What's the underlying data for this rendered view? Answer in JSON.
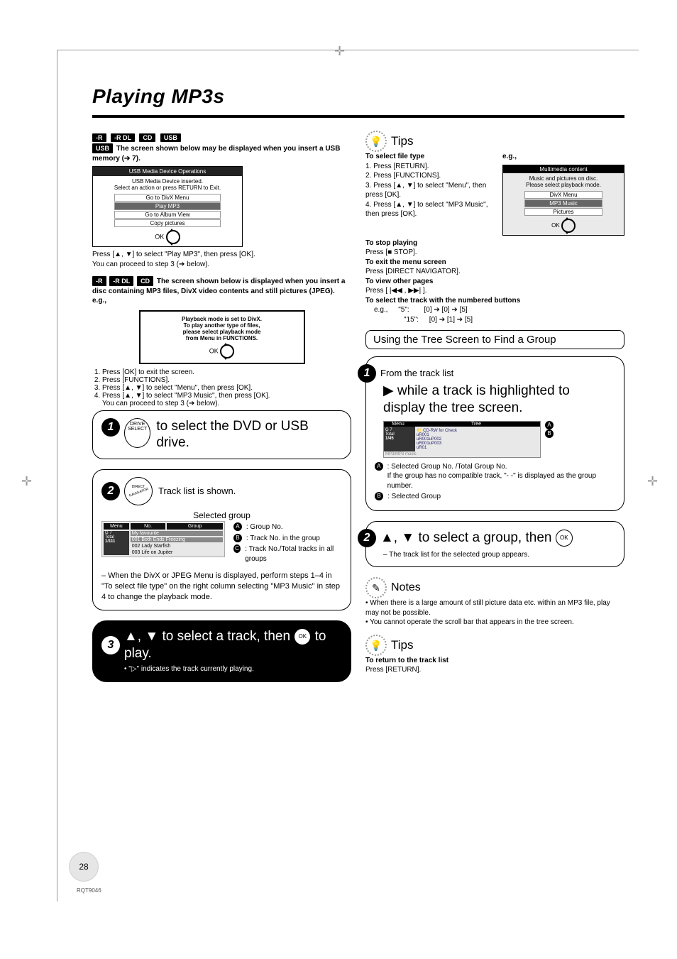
{
  "title": "Playing MP3s",
  "badges": {
    "r": "-R",
    "rdl": "-R DL",
    "cd": "CD",
    "usb": "USB"
  },
  "left": {
    "usb_note": "The screen shown below may be displayed when you insert a USB memory (➔ 7).",
    "usb_panel": {
      "header": "USB Media Device Operations",
      "sub": "USB Media Device inserted.\nSelect an action or press RETURN to Exit.",
      "rows": [
        "Go to DivX Menu",
        "Play MP3",
        "Go to Album View",
        "Copy pictures"
      ],
      "ok": "OK"
    },
    "after_panel": "Press [▲, ▼] to select \"Play MP3\", then press [OK].\nYou can proceed to step 3 (➔ below).",
    "disc_note": "The screen shown below is displayed when you insert a disc containing MP3 files, DivX video contents and still pictures (JPEG).",
    "eg": "e.g.,",
    "modal": {
      "line": "Playback mode is set to DivX.\nTo play another type of files,\nplease select playback mode\nfrom Menu in FUNCTIONS.",
      "ok": "OK"
    },
    "steps_pre": {
      "s1": "Press [OK] to exit the screen.",
      "s2": "Press [FUNCTIONS].",
      "s3": "Press [▲, ▼] to select \"Menu\", then press [OK].",
      "s4": "Press [▲, ▼] to select \"MP3 Music\", then press [OK].\nYou can proceed to step 3 (➔ below)."
    },
    "big1": {
      "btn": "DRIVE\nSELECT",
      "text": "to select the DVD or USB drive."
    },
    "big2": {
      "text": "Track list is shown.",
      "selgrp": "Selected group",
      "la": "Group No.",
      "lb": "Track No. in the group",
      "lc": "Track No./Total tracks in all groups",
      "note": "– When the DivX or JPEG Menu is displayed, perform steps 1–4 in \"To select file type\" on the right column selecting \"MP3 Music\" in step 4 to change the playback mode.",
      "table": {
        "menu": "Menu",
        "no": "No.",
        "group": "Group",
        "g": "G",
        "t": "Total",
        "gv": "7",
        "tv": "1",
        "totv": "1/111",
        "r1": "001 Both Ends Freezing",
        "r2": "002 Lady Starfish",
        "r3": "003 Life on Jupiter",
        "grp": "My favourite"
      }
    },
    "big3": {
      "text": "▲, ▼ to select a track, then",
      "to_play": "to play.",
      "foot": "• \"▷\" indicates the track currently playing.",
      "ok": "OK"
    }
  },
  "right": {
    "tips1": "Tips",
    "sel_type": {
      "h": "To select file type",
      "s1": "1. Press [RETURN].",
      "s2": "2. Press [FUNCTIONS].",
      "s3": "3. Press [▲, ▼] to select \"Menu\", then press [OK].",
      "s4": "4. Press [▲, ▼] to select \"MP3 Music\", then press [OK]."
    },
    "panel_lg": {
      "eg": "e.g.,",
      "title": "Multimedia content",
      "sub": "Music and pictures on disc.\nPlease select playback mode.",
      "rows": [
        "DivX Menu",
        "MP3 Music",
        "Pictures"
      ],
      "ok": "OK"
    },
    "stop": {
      "h": "To stop playing",
      "b": "Press [■ STOP]."
    },
    "exit": {
      "h": "To exit the menu screen",
      "b": "Press [DIRECT NAVIGATOR]."
    },
    "other": {
      "h": "To view other pages",
      "b": "Press [ |◀◀ , ▶▶| ]."
    },
    "numbered": {
      "h": "To select the track with the numbered buttons",
      "eg": "e.g.,",
      "ex1k": "\"5\":",
      "ex1v": "[0] ➔ [0] ➔ [5]",
      "ex2k": "\"15\":",
      "ex2v": "[0] ➔ [1] ➔ [5]"
    },
    "sect": "Using the Tree Screen to Find a Group",
    "tree1": {
      "from": "From the track list",
      "line": "▶ while a track is highlighted to display the tree screen.",
      "panel": {
        "menu": "Menu",
        "tree": "Tree",
        "g": "G",
        "gv": "7",
        "t": "T",
        "tv": "1",
        "tot": "Total",
        "totv": "1/45",
        "items": "📁 CD-RW for Check\n   uR001\n   uR001uP002\n   uR001uP003\n   uR01",
        "foot": "MP3/MP3 music"
      },
      "la": "Selected Group No. /Total Group No.\nIf the group has no compatible track, \"- -\" is displayed as the group number.",
      "lb": "Selected Group"
    },
    "tree2": {
      "line": "▲, ▼ to select a group, then",
      "ok": "OK",
      "sub": "– The track list for the selected group appears."
    },
    "notes": {
      "h": "Notes",
      "n1": "• When there is a large amount of still picture data etc. within an MP3 file, play may not be possible.",
      "n2": "• You cannot operate the scroll bar that appears in the tree screen."
    },
    "tips2": {
      "h": "Tips",
      "t": "To return to the track list",
      "b": "Press [RETURN]."
    }
  },
  "page_number": "28",
  "doc_id": "RQT9046"
}
